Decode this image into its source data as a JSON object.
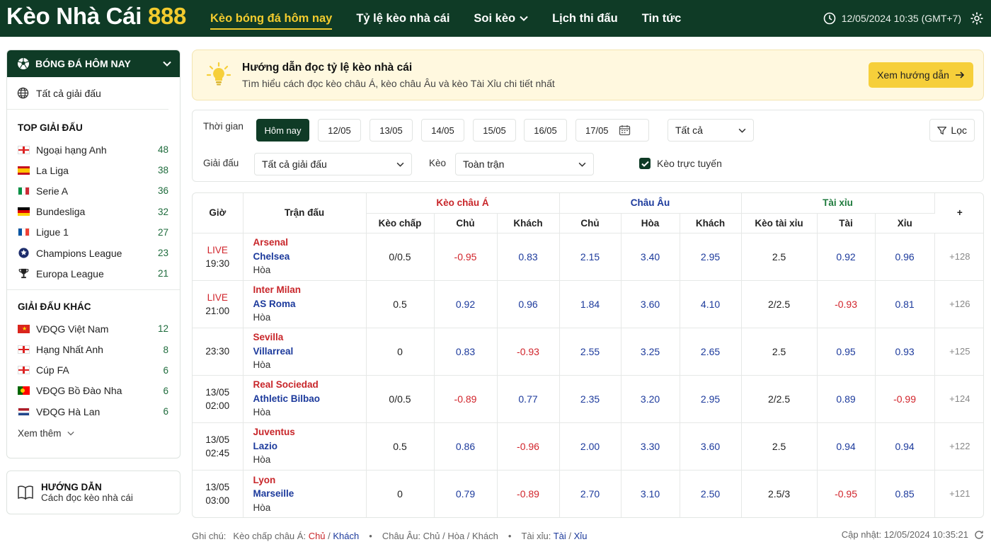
{
  "header": {
    "logo_text": "Kèo Nhà Cái",
    "logo_num": "888",
    "nav": [
      {
        "label": "Kèo bóng đá hôm nay",
        "active": true
      },
      {
        "label": "Tỷ lệ kèo nhà cái",
        "active": false
      },
      {
        "label": "Soi kèo",
        "active": false,
        "dropdown": true
      },
      {
        "label": "Lịch thi đấu",
        "active": false
      },
      {
        "label": "Tin tức",
        "active": false
      }
    ],
    "datetime": "12/05/2024 10:35 (GMT+7)"
  },
  "sidebar": {
    "title": "BÓNG ĐÁ HÔM NAY",
    "all_leagues": "Tất cả giải đấu",
    "top_title": "TOP GIẢI ĐẤU",
    "top": [
      {
        "name": "Ngoại hạng Anh",
        "count": "48",
        "flag": "england"
      },
      {
        "name": "La Liga",
        "count": "38",
        "flag": "spain"
      },
      {
        "name": "Serie A",
        "count": "36",
        "flag": "italy"
      },
      {
        "name": "Bundesliga",
        "count": "32",
        "flag": "germany"
      },
      {
        "name": "Ligue 1",
        "count": "27",
        "flag": "france"
      },
      {
        "name": "Champions League",
        "count": "23",
        "flag": "ucl"
      },
      {
        "name": "Europa League",
        "count": "21",
        "flag": "uel"
      }
    ],
    "other_title": "GIẢI ĐẤU KHÁC",
    "other": [
      {
        "name": "VĐQG Việt Nam",
        "count": "12",
        "flag": "vietnam"
      },
      {
        "name": "Hạng Nhất Anh",
        "count": "8",
        "flag": "england"
      },
      {
        "name": "Cúp FA",
        "count": "6",
        "flag": "england"
      },
      {
        "name": "VĐQG Bồ Đào Nha",
        "count": "6",
        "flag": "portugal"
      },
      {
        "name": "VĐQG Hà Lan",
        "count": "6",
        "flag": "netherlands"
      }
    ],
    "more": "Xem thêm",
    "guide_title": "HƯỚNG DẪN",
    "guide_sub": "Cách đọc kèo nhà cái"
  },
  "banner": {
    "title": "Hướng dẫn đọc tỷ lệ kèo nhà cái",
    "subtitle": "Tìm hiểu cách đọc kèo châu Á, kèo châu Âu và kèo Tài Xỉu chi tiết nhất",
    "button": "Xem hướng dẫn"
  },
  "filters": {
    "time_label": "Thời gian",
    "dates": [
      "Hôm nay",
      "12/05",
      "13/05",
      "14/05",
      "15/05",
      "16/05",
      "17/05"
    ],
    "status_select": "Tất cả",
    "filter_button": "Lọc",
    "league_label": "Giải đấu",
    "league_select": "Tất cả giải đấu",
    "odds_label": "Kèo",
    "odds_select": "Toàn trận",
    "live_checkbox": "Kèo trực tuyến",
    "live_checked": true
  },
  "table": {
    "h_time": "Giờ",
    "h_match": "Trận đấu",
    "g_asia": "Kèo châu Á",
    "g_euro": "Châu Âu",
    "g_ou": "Tài xỉu",
    "h_more": "+",
    "sub": [
      "Kèo chấp",
      "Chủ",
      "Khách",
      "Chủ",
      "Hòa",
      "Khách",
      "Kèo tài xỉu",
      "Tài",
      "Xỉu"
    ],
    "rows": [
      {
        "status": "LIVE",
        "time": "19:30",
        "home": "Arsenal",
        "away": "Chelsea",
        "draw": "Hòa",
        "hcp": "0/0.5",
        "a_home": "-0.95",
        "a_away": "0.83",
        "e_home": "2.15",
        "e_draw": "3.40",
        "e_away": "2.95",
        "ou": "2.5",
        "over": "0.92",
        "under": "0.96",
        "more": "+128"
      },
      {
        "status": "LIVE",
        "time": "21:00",
        "home": "Inter Milan",
        "away": "AS Roma",
        "draw": "Hòa",
        "hcp": "0.5",
        "a_home": "0.92",
        "a_away": "0.96",
        "e_home": "1.84",
        "e_draw": "3.60",
        "e_away": "4.10",
        "ou": "2/2.5",
        "over": "-0.93",
        "under": "0.81",
        "more": "+126"
      },
      {
        "status": "",
        "time": "23:30",
        "home": "Sevilla",
        "away": "Villarreal",
        "draw": "Hòa",
        "hcp": "0",
        "a_home": "0.83",
        "a_away": "-0.93",
        "e_home": "2.55",
        "e_draw": "3.25",
        "e_away": "2.65",
        "ou": "2.5",
        "over": "0.95",
        "under": "0.93",
        "more": "+125"
      },
      {
        "status": "13/05",
        "time": "02:00",
        "home": "Real Sociedad",
        "away": "Athletic Bilbao",
        "draw": "Hòa",
        "hcp": "0/0.5",
        "a_home": "-0.89",
        "a_away": "0.77",
        "e_home": "2.35",
        "e_draw": "3.20",
        "e_away": "2.95",
        "ou": "2/2.5",
        "over": "0.89",
        "under": "-0.99",
        "more": "+124"
      },
      {
        "status": "13/05",
        "time": "02:45",
        "home": "Juventus",
        "away": "Lazio",
        "draw": "Hòa",
        "hcp": "0.5",
        "a_home": "0.86",
        "a_away": "-0.96",
        "e_home": "2.00",
        "e_draw": "3.30",
        "e_away": "3.60",
        "ou": "2.5",
        "over": "0.94",
        "under": "0.94",
        "more": "+122"
      },
      {
        "status": "13/05",
        "time": "03:00",
        "home": "Lyon",
        "away": "Marseille",
        "draw": "Hòa",
        "hcp": "0",
        "a_home": "0.79",
        "a_away": "-0.89",
        "e_home": "2.70",
        "e_draw": "3.10",
        "e_away": "2.50",
        "ou": "2.5/3",
        "over": "-0.95",
        "under": "0.85",
        "more": "+121"
      }
    ]
  },
  "footer": {
    "note_label": "Ghi chú:",
    "asia_text": "Kèo chấp châu Á:",
    "asia_home": "Chủ",
    "asia_away": "Khách",
    "euro_text": "Châu Âu: Chủ / Hòa / Khách",
    "ou_text": "Tài xỉu:",
    "ou_over": "Tài",
    "ou_under": "Xỉu",
    "updated": "Cập nhật: 12/05/2024 10:35:21"
  }
}
